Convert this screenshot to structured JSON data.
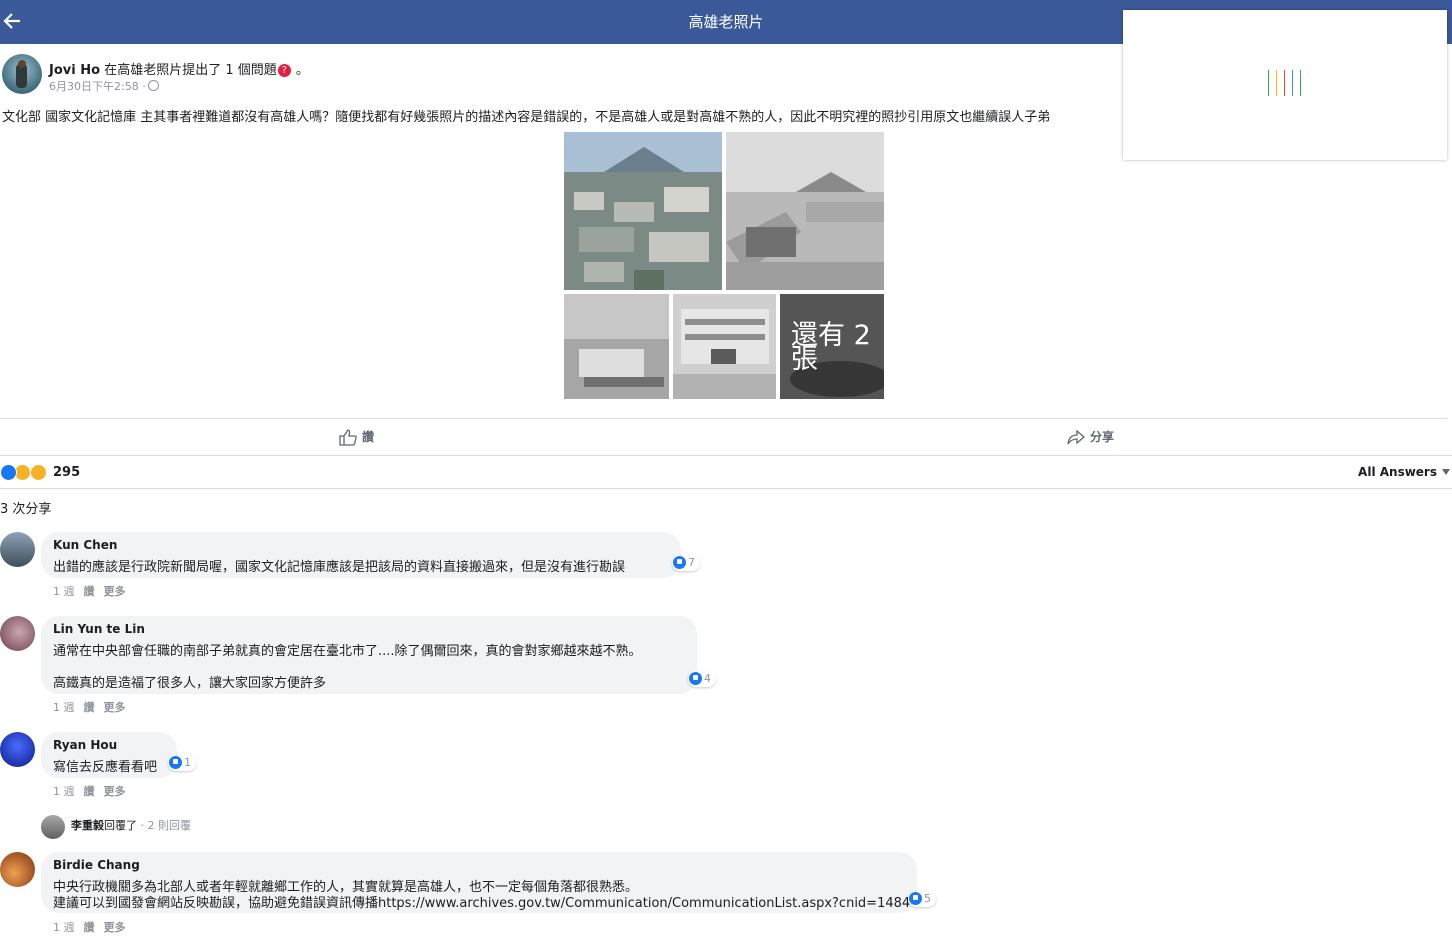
{
  "header": {
    "title": "高雄老照片",
    "back_icon": "arrow-left-icon",
    "bg": "#3b5998"
  },
  "loading_popup": {
    "spinner_colors": [
      "#34a853",
      "#fbbc05",
      "#ea4335",
      "#4285f4"
    ]
  },
  "post": {
    "author": "Jovi Ho",
    "in_word": " 在",
    "group": "高雄老照片",
    "action": "提出了 1 個問題",
    "action_end": " 。",
    "question_icon": "question-badge-icon",
    "time": "6月30日下午2:58 ·",
    "privacy_icon": "globe-icon",
    "text": "文化部 國家文化記憶庫 主其事者裡難道都沒有高雄人嗎？隨便找都有好幾張照片的描述內容是錯誤的，不是高雄人或是對高雄不熟的人，因此不明究裡的照抄引用原文也繼續誤人子弟",
    "more_photos": "還有 2 張"
  },
  "actions": {
    "like": "讚",
    "share": "分享"
  },
  "reactions": {
    "count": "295",
    "icons": [
      "like-reaction-icon",
      "wow-reaction-icon",
      "haha-reaction-icon"
    ]
  },
  "all_answers": "All Answers",
  "share_count": "3 次分享",
  "comments": [
    {
      "name": "Kun Chen",
      "lines": [
        "出錯的應該是行政院新聞局喔，國家文化記憶庫應該是把該局的資料直接搬過來，但是沒有進行勘誤"
      ],
      "likes": "7",
      "time": "1 週",
      "like": "讚",
      "more": "更多"
    },
    {
      "name": "Lin Yun te Lin",
      "lines": [
        "通常在中央部會任職的南部子弟就真的會定居在臺北市了....除了偶爾回來，真的會對家鄉越來越不熟。",
        "高鐵真的是造福了很多人，讓大家回家方便許多"
      ],
      "likes": "4",
      "time": "1 週",
      "like": "讚",
      "more": "更多"
    },
    {
      "name": "Ryan Hou",
      "lines": [
        "寫信去反應看看吧"
      ],
      "likes": "1",
      "time": "1 週",
      "like": "讚",
      "more": "更多"
    },
    {
      "name": "Birdie Chang",
      "lines": [
        "中央行政機關多為北部人或者年輕就離鄉工作的人，其實就算是高雄人，也不一定每個角落都很熟悉。",
        "建議可以到國發會網站反映勘誤，協助避免錯誤資訊傳播https://www.archives.gov.tw/Communication/CommunicationList.aspx?cnid=1484"
      ],
      "likes": "5",
      "time": "1 週",
      "like": "讚",
      "more": "更多"
    }
  ],
  "reply_summary": {
    "name": "李重毅",
    "action": "回覆了",
    "count": " · 2 則回覆"
  }
}
